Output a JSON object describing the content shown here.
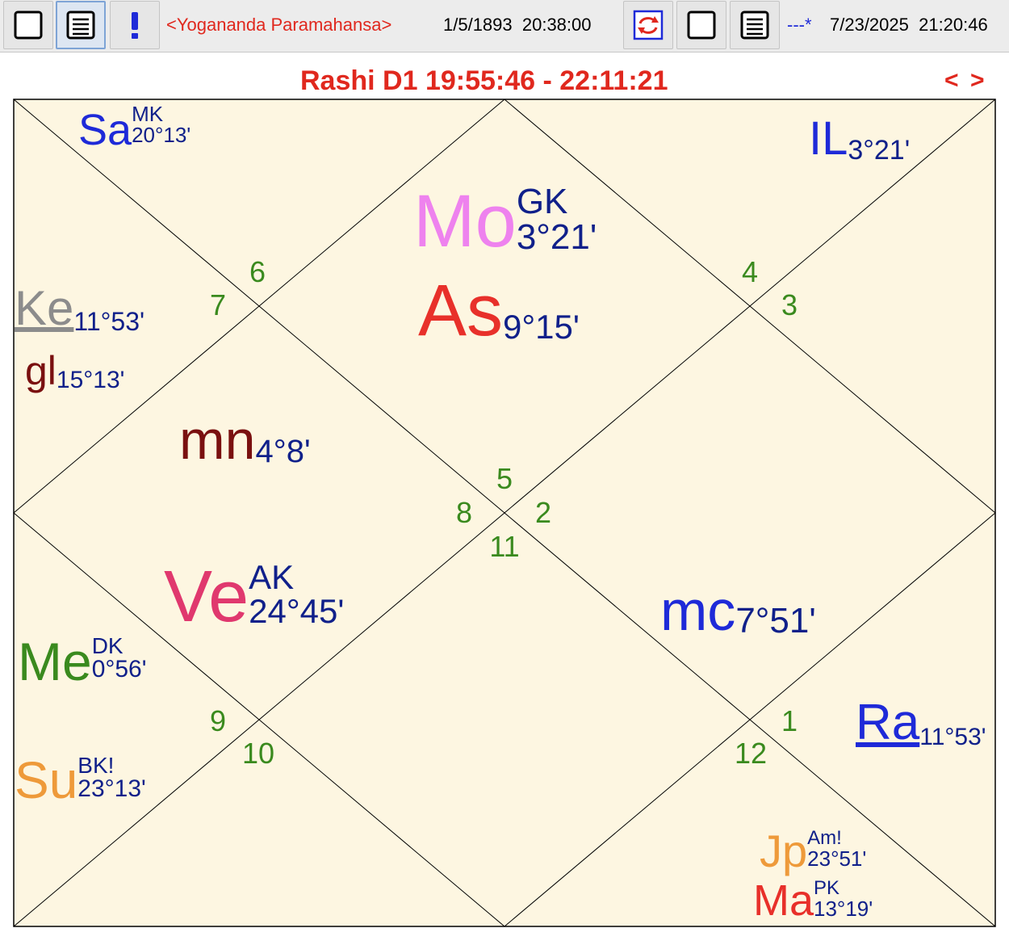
{
  "toolbar": {
    "buttons": [
      {
        "name": "blank-page-icon",
        "active": false
      },
      {
        "name": "text-page-icon",
        "active": true
      },
      {
        "name": "exclamation-icon",
        "active": false
      }
    ],
    "person_name": "<Yogananda Paramahansa>",
    "birth_datetime": "1/5/1893  20:38:00",
    "transit_marker": "---*",
    "transit_datetime": "7/23/2025  21:20:46",
    "colors": {
      "red": "#e0281e",
      "blue": "#1e2ad8"
    }
  },
  "chart": {
    "title": "Rashi D1 19:55:46 - 22:11:21",
    "nav_prev": "<",
    "nav_next": ">",
    "background": "#fdf6e1",
    "house_numbers": [
      "1",
      "2",
      "3",
      "4",
      "5",
      "6",
      "7",
      "8",
      "9",
      "10",
      "11",
      "12"
    ],
    "placements": [
      {
        "abbr": "Sa",
        "role": "MK",
        "degree": "20°13'",
        "color": "#1e2ad8"
      },
      {
        "abbr": "IL",
        "role": "",
        "degree": "3°21'",
        "color": "#1e2ad8"
      },
      {
        "abbr": "Mo",
        "role": "GK",
        "degree": "3°21'",
        "color": "#ee82ee"
      },
      {
        "abbr": "As",
        "role": "",
        "degree": "9°15'",
        "color": "#e8302a"
      },
      {
        "abbr": "Ke",
        "role": "",
        "degree": "11°53'",
        "color": "#8c8c8c"
      },
      {
        "abbr": "gl",
        "role": "",
        "degree": "15°13'",
        "color": "#7a1010"
      },
      {
        "abbr": "mn",
        "role": "",
        "degree": "4°8'",
        "color": "#7a1010"
      },
      {
        "abbr": "Ve",
        "role": "AK",
        "degree": "24°45'",
        "color": "#e0386e"
      },
      {
        "abbr": "mc",
        "role": "",
        "degree": "7°51'",
        "color": "#1e2ad8"
      },
      {
        "abbr": "Me",
        "role": "DK",
        "degree": "0°56'",
        "color": "#3a8a1e"
      },
      {
        "abbr": "Su",
        "role": "BK!",
        "degree": "23°13'",
        "color": "#ee9a3a"
      },
      {
        "abbr": "Ra",
        "role": "",
        "degree": "11°53'",
        "color": "#1e2ad8"
      },
      {
        "abbr": "Jp",
        "role": "Am!",
        "degree": "23°51'",
        "color": "#ee9a3a"
      },
      {
        "abbr": "Ma",
        "role": "PK",
        "degree": "13°19'",
        "color": "#e8302a"
      }
    ]
  }
}
